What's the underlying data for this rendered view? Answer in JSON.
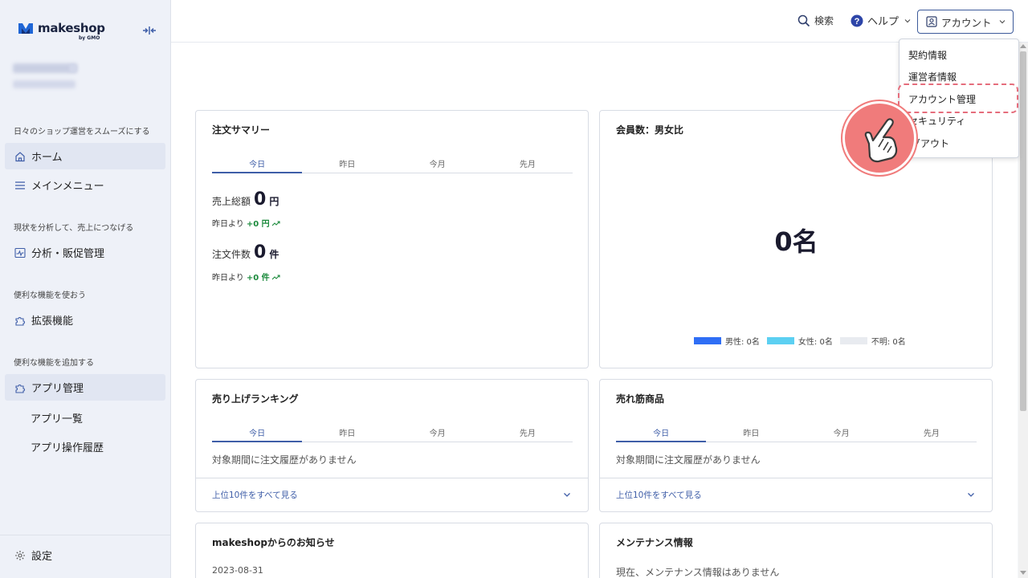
{
  "sidebar": {
    "brand": "makeshop",
    "brand_sub": "by GMO",
    "sections": {
      "daily": "日々のショップ運営をスムーズにする",
      "analyze": "現状を分析して、売上につなげる",
      "use": "便利な機能を使おう",
      "add": "便利な機能を追加する"
    },
    "items": {
      "home": "ホーム",
      "main_menu": "メインメニュー",
      "analytics": "分析・販促管理",
      "extensions": "拡張機能",
      "apps": "アプリ管理",
      "app_list": "アプリ一覧",
      "app_history": "アプリ操作履歴",
      "settings": "設定"
    }
  },
  "topbar": {
    "search": "検索",
    "help": "ヘルプ",
    "account": "アカウント"
  },
  "dropdown": {
    "items": [
      "契約情報",
      "運営者情報",
      "アカウント管理",
      "セキュリティ",
      "ログアウト"
    ],
    "visible_items": [
      "契約情報",
      "運営者情報",
      "アカウント管理",
      "セキュリティ",
      "グアウト"
    ]
  },
  "tabs": [
    "今日",
    "昨日",
    "今月",
    "先月"
  ],
  "order_summary": {
    "title": "注文サマリー",
    "sales_label": "売上総額",
    "sales_value": "0",
    "sales_unit": "円",
    "sales_delta_label": "昨日より",
    "sales_delta": "+0 円",
    "orders_label": "注文件数",
    "orders_value": "0",
    "orders_unit": "件",
    "orders_delta_label": "昨日より",
    "orders_delta": "+0 件"
  },
  "members": {
    "title": "会員数：男女比",
    "count": "0名",
    "legend": [
      {
        "label": "男性: 0名",
        "color": "#2f6ef5"
      },
      {
        "label": "女性: 0名",
        "color": "#5cd0f2"
      },
      {
        "label": "不明: 0名",
        "color": "#e8ebf0"
      }
    ]
  },
  "ranking": {
    "title": "売り上げランキング",
    "empty": "対象期間に注文履歴がありません",
    "link": "上位10件をすべて見る"
  },
  "best_sellers": {
    "title": "売れ筋商品",
    "empty": "対象期間に注文履歴がありません",
    "link": "上位10件をすべて見る"
  },
  "news": {
    "title": "makeshopからのお知らせ",
    "date": "2023-08-31"
  },
  "maintenance": {
    "title": "メンテナンス情報",
    "message": "現在、メンテナンス情報はありません"
  },
  "colors": {
    "accent": "#3f5ea8",
    "positive": "#1b8a3c",
    "highlight": "#e56d7c"
  }
}
